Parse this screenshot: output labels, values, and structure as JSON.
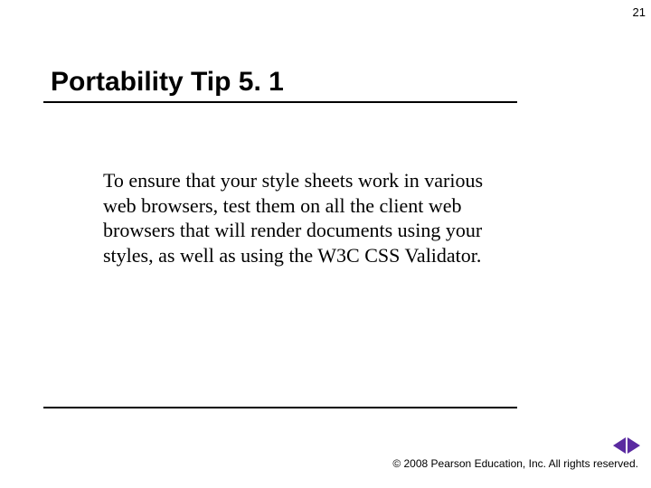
{
  "page_number": "21",
  "title": "Portability Tip 5. 1",
  "body": "To ensure that your style sheets work in various web browsers, test them on all the client web browsers that will render documents using your styles, as well as using the W3C CSS Validator.",
  "copyright": "© 2008 Pearson Education, Inc. All rights reserved."
}
